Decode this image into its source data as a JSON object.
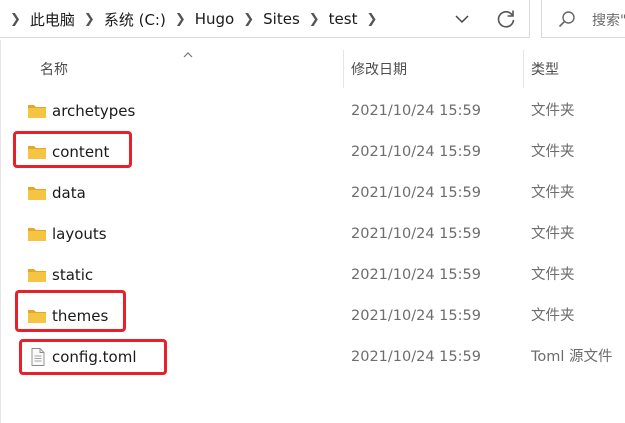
{
  "address": {
    "breadcrumbs": [
      "此电脑",
      "系统 (C:)",
      "Hugo",
      "Sites",
      "test"
    ]
  },
  "search": {
    "placeholder": "搜索\""
  },
  "columns": {
    "name": "名称",
    "modified": "修改日期",
    "type": "类型"
  },
  "files": [
    {
      "name": "archetypes",
      "modified": "2021/10/24 15:59",
      "type": "文件夹",
      "kind": "folder-icon",
      "highlighted": false
    },
    {
      "name": "content",
      "modified": "2021/10/24 15:59",
      "type": "文件夹",
      "kind": "folder-icon",
      "highlighted": true
    },
    {
      "name": "data",
      "modified": "2021/10/24 15:59",
      "type": "文件夹",
      "kind": "folder-icon",
      "highlighted": false
    },
    {
      "name": "layouts",
      "modified": "2021/10/24 15:59",
      "type": "文件夹",
      "kind": "folder-icon",
      "highlighted": false
    },
    {
      "name": "static",
      "modified": "2021/10/24 15:59",
      "type": "文件夹",
      "kind": "folder-icon",
      "highlighted": false
    },
    {
      "name": "themes",
      "modified": "2021/10/24 15:59",
      "type": "文件夹",
      "kind": "folder-icon",
      "highlighted": true
    },
    {
      "name": "config.toml",
      "modified": "2021/10/24 15:59",
      "type": "Toml 源文件",
      "kind": "file-icon",
      "highlighted": true
    }
  ],
  "colors": {
    "highlight": "#e8202a",
    "folder": "#f6c443",
    "folder_dark": "#e2a826"
  }
}
